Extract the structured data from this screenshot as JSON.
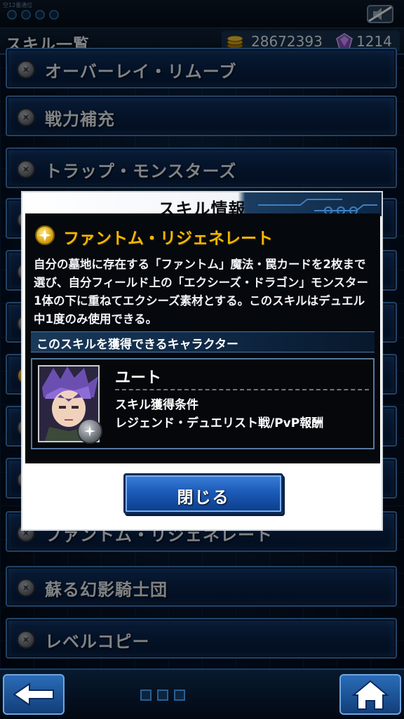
{
  "status": {
    "small_text": "空12番通位"
  },
  "header": {
    "title": "スキル一覧",
    "gold": "28672393",
    "gems": "1214"
  },
  "skills": [
    {
      "name": "オーバーレイ・リムーブ"
    },
    {
      "name": "戦力補充"
    },
    {
      "name": "トラップ・モンスターズ"
    },
    {
      "name": "ファントム・リジェネレート"
    },
    {
      "name": "蘇る幻影騎士団"
    },
    {
      "name": "レベルコピー"
    }
  ],
  "dialog": {
    "title": "スキル情報",
    "skill_name": "ファントム・リジェネレート",
    "description": "自分の墓地に存在する「ファントム」魔法・罠カードを2枚まで選び、自分フィールド上の「エクシーズ・ドラゴン」モンスター1体の下に重ねてエクシーズ素材とする。このスキルはデュエル中1度のみ使用できる。",
    "section_label": "このスキルを獲得できるキャラクター",
    "character": {
      "name": "ユート",
      "condition_label": "スキル獲得条件",
      "condition_value": "レジェンド・デュエリスト戦/PvP報酬"
    },
    "close_label": "閉じる"
  },
  "colors": {
    "skill_title": "#f6b800",
    "button_blue": "#1c5bb8",
    "list_border": "#3f79b8"
  }
}
